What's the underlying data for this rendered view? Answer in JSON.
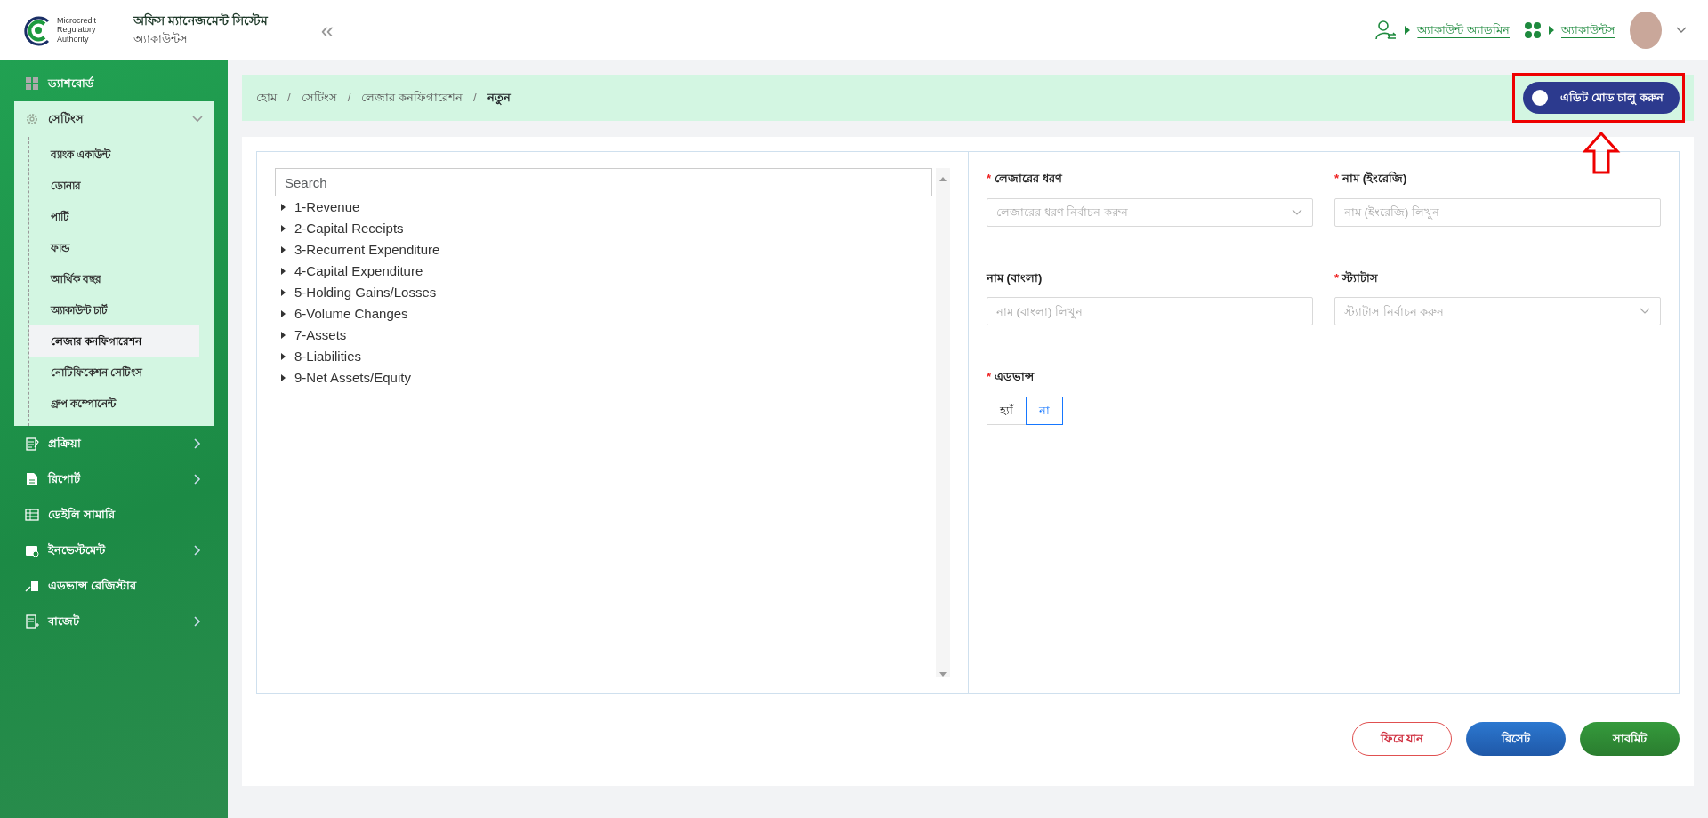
{
  "header": {
    "logo_text": "Microcredit Regulatory Authority",
    "app_title": "অফিস ম্যানেজমেন্ট সিস্টেম",
    "app_subtitle": "অ্যাকাউন্টস",
    "collapse": "«",
    "links": [
      {
        "label": "অ্যাকাউন্ট অ্যাডমিন"
      },
      {
        "label": "অ্যাকাউন্টস"
      }
    ]
  },
  "sidebar": {
    "items": [
      {
        "label": "ড্যাশবোর্ড",
        "has_submenu": false,
        "expanded": false
      },
      {
        "label": "সেটিংস",
        "has_submenu": true,
        "expanded": true,
        "children": [
          {
            "label": "ব্যাংক একাউন্ট",
            "selected": false
          },
          {
            "label": "ডোনার",
            "selected": false
          },
          {
            "label": "পার্টি",
            "selected": false
          },
          {
            "label": "ফান্ড",
            "selected": false
          },
          {
            "label": "আর্থিক বছর",
            "selected": false
          },
          {
            "label": "অ্যাকাউন্ট চার্ট",
            "selected": false
          },
          {
            "label": "লেজার কনফিগারেশন",
            "selected": true
          },
          {
            "label": "নোটিফিকেশন সেটিংস",
            "selected": false
          },
          {
            "label": "গ্রুপ কম্পোনেন্ট",
            "selected": false
          }
        ]
      },
      {
        "label": "প্রক্রিয়া",
        "has_submenu": true,
        "expanded": false
      },
      {
        "label": "রিপোর্ট",
        "has_submenu": true,
        "expanded": false
      },
      {
        "label": "ডেইলি সামারি",
        "has_submenu": false,
        "expanded": false
      },
      {
        "label": "ইনভেস্টমেন্ট",
        "has_submenu": true,
        "expanded": false
      },
      {
        "label": "এডভান্স রেজিস্টার",
        "has_submenu": false,
        "expanded": false
      },
      {
        "label": "বাজেট",
        "has_submenu": true,
        "expanded": false
      }
    ]
  },
  "breadcrumb": [
    "হোম",
    "সেটিংস",
    "লেজার কনফিগারেশন",
    "নতুন"
  ],
  "breadcrumb_separator": "/",
  "edit_mode_toggle": {
    "label": "এডিট মোড চালু করুন",
    "on": false
  },
  "tree": {
    "search": {
      "placeholder": "Search"
    },
    "items": [
      {
        "label": "1-Revenue",
        "expanded": false
      },
      {
        "label": "2-Capital Receipts",
        "expanded": false
      },
      {
        "label": "3-Recurrent Expenditure",
        "expanded": false
      },
      {
        "label": "4-Capital Expenditure",
        "expanded": false
      },
      {
        "label": "5-Holding Gains/Losses",
        "expanded": false
      },
      {
        "label": "6-Volume Changes",
        "expanded": false
      },
      {
        "label": "7-Assets",
        "expanded": false
      },
      {
        "label": "8-Liabilities",
        "expanded": false
      },
      {
        "label": "9-Net Assets/Equity",
        "expanded": false
      }
    ]
  },
  "form": {
    "required_mark": "*",
    "fields": [
      {
        "kind": "select",
        "label": "লেজারের ধরণ",
        "required": true,
        "placeholder": "লেজারের ধরণ নির্বাচন করুন"
      },
      {
        "kind": "text",
        "label": "নাম (ইংরেজি)",
        "required": true,
        "placeholder": "নাম (ইংরেজি) লিখুন"
      },
      {
        "kind": "text",
        "label": "নাম (বাংলা)",
        "required": false,
        "placeholder": "নাম (বাংলা) লিখুন"
      },
      {
        "kind": "select",
        "label": "স্ট্যাটাস",
        "required": true,
        "placeholder": "স্ট্যাটাস নির্বাচন করুন"
      }
    ],
    "advance": {
      "label": "এডভান্স",
      "required": true,
      "options": [
        {
          "label": "হ্যাঁ",
          "selected": false
        },
        {
          "label": "না",
          "selected": true
        }
      ]
    }
  },
  "buttons": [
    {
      "kind": "back",
      "label": "ফিরে যান"
    },
    {
      "kind": "reset",
      "label": "রিসেট"
    },
    {
      "kind": "submit",
      "label": "সাবমিট"
    }
  ]
}
